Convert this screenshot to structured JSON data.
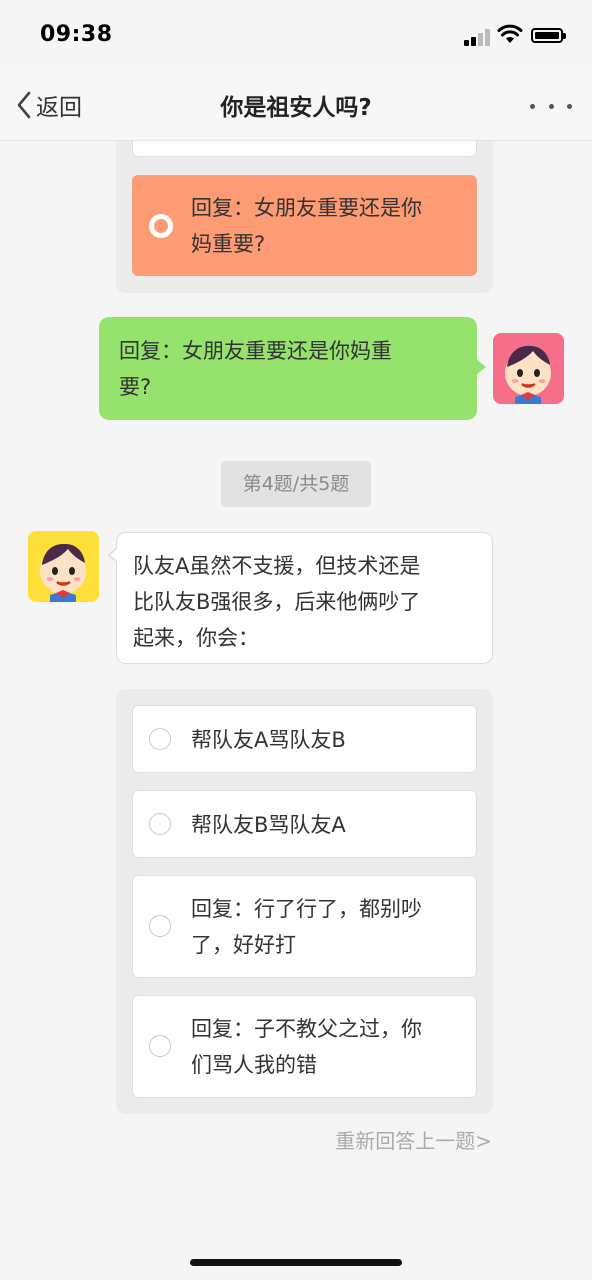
{
  "status_bar": {
    "time": "09:38",
    "signal_icon": "cellular-signal-icon",
    "wifi_icon": "wifi-icon",
    "battery_icon": "battery-icon",
    "battery_level": 0.85
  },
  "nav": {
    "back_label": "返回",
    "back_icon": "chevron-left-icon",
    "title": "你是祖安人吗?",
    "more_icon": "more-dots-icon"
  },
  "previous_question": {
    "options": [
      {
        "label": "",
        "selected": false
      },
      {
        "label": "回复：女朋友重要还是你妈重要?",
        "line1": "回复：女朋友重要还是你",
        "line2": "妈重要?",
        "selected": true
      }
    ]
  },
  "user_reply": {
    "line1": "回复：女朋友重要还是你妈重",
    "line2": "要?"
  },
  "progress": {
    "label": "第4题/共5题",
    "current": 4,
    "total": 5
  },
  "question": {
    "line1": "队友A虽然不支援，但技术还是",
    "line2": "比队友B强很多，后来他俩吵了",
    "line3": "起来，你会："
  },
  "options": [
    {
      "line1": "帮队友A骂队友B",
      "line2": ""
    },
    {
      "line1": "帮队友B骂队友A",
      "line2": ""
    },
    {
      "line1": "回复：行了行了，都别吵",
      "line2": "了，好好打"
    },
    {
      "line1": "回复：子不教父之过，你",
      "line2": "们骂人我的错"
    }
  ],
  "redo_link": "重新回答上一题>",
  "colors": {
    "selected_option": "#fc9b74",
    "user_bubble": "#95e36d",
    "user_avatar_bg": "#f56f8b",
    "bot_avatar_bg": "#ffe03a"
  }
}
